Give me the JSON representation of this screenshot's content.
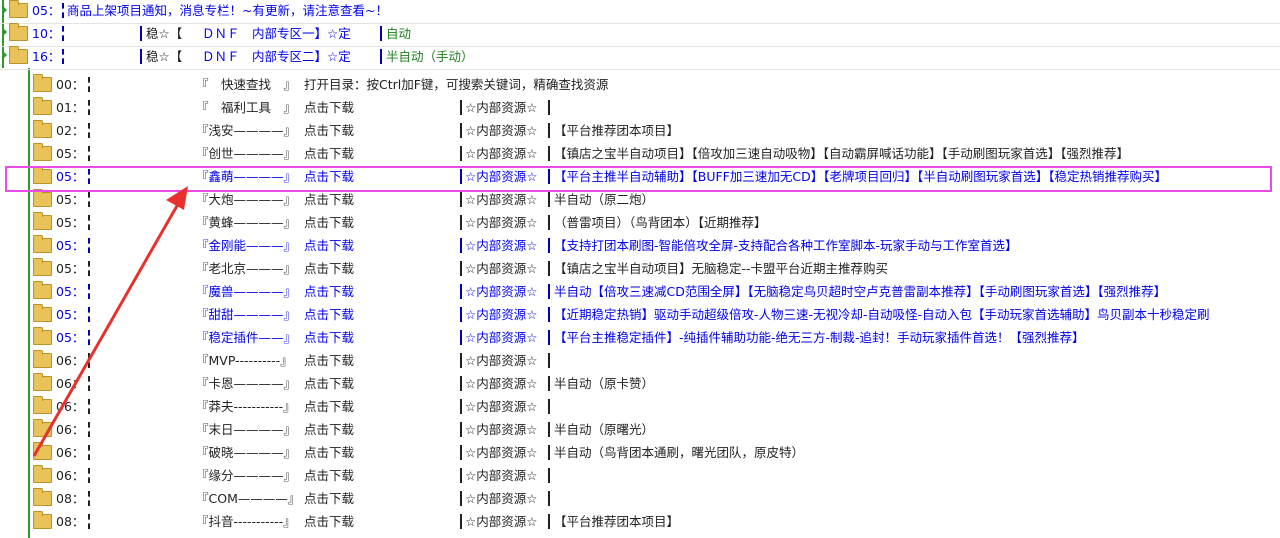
{
  "top_rows": [
    {
      "num": "05：",
      "text": "商品上架项目通知，消息专栏！~有更新，请注意查看~！"
    },
    {
      "num": "10：",
      "star_name": "稳☆【",
      "zone": "ＤＮＦ　内部专区一】☆定",
      "tag": "自动"
    },
    {
      "num": "16：",
      "star_name": "稳☆【",
      "zone": "ＤＮＦ　内部专区二】☆定",
      "tag": "半自动（手动）"
    }
  ],
  "rows": [
    {
      "num": "00：",
      "name": "『　快速查找　』",
      "action": "打开目录：按Ctrl加F键，可搜索关键词，精确查找资源",
      "res": "",
      "desc": "",
      "blue": false
    },
    {
      "num": "01：",
      "name": "『　福利工具　』",
      "action": "点击下载",
      "res": "☆内部资源☆",
      "desc": "",
      "blue": false
    },
    {
      "num": "02：",
      "name": "『浅安————』",
      "action": "点击下载",
      "res": "☆内部资源☆",
      "desc": "【平台推荐团本项目】",
      "blue": false
    },
    {
      "num": "05：",
      "name": "『创世————』",
      "action": "点击下载",
      "res": "☆内部资源☆",
      "desc": "【镇店之宝半自动项目】【倍攻加三速自动吸物】【自动霸屏喊话功能】【手动刷图玩家首选】【强烈推荐】",
      "blue": false
    },
    {
      "num": "05：",
      "name": "『鑫萌————』",
      "action": "点击下载",
      "res": "☆内部资源☆",
      "desc": "【平台主推半自动辅助】【BUFF加三速加无CD】【老牌项目回归】【半自动刷图玩家首选】【稳定热销推荐购买】",
      "blue": true
    },
    {
      "num": "05：",
      "name": "『大炮————』",
      "action": "点击下载",
      "res": "☆内部资源☆",
      "desc": "半自动（原二炮）",
      "blue": false
    },
    {
      "num": "05：",
      "name": "『黄蜂————』",
      "action": "点击下载",
      "res": "☆内部资源☆",
      "desc": "（普雷项目）（鸟背团本）【近期推荐】",
      "blue": false
    },
    {
      "num": "05：",
      "name": "『金刚能———』",
      "action": "点击下载",
      "res": "☆内部资源☆",
      "desc": "【支持打团本刷图-智能倍攻全屏-支持配合各种工作室脚本-玩家手动与工作室首选】",
      "blue": true
    },
    {
      "num": "05：",
      "name": "『老北京———』",
      "action": "点击下载",
      "res": "☆内部资源☆",
      "desc": "【镇店之宝半自动项目】无脑稳定--卡盟平台近期主推荐购买",
      "blue": false
    },
    {
      "num": "05：",
      "name": "『魔兽————』",
      "action": "点击下载",
      "res": "☆内部资源☆",
      "desc": "半自动【倍攻三速减CD范围全屏】【无脑稳定鸟贝超时空卢克普雷副本推荐】【手动刷图玩家首选】【强烈推荐】",
      "blue": true
    },
    {
      "num": "05：",
      "name": "『甜甜————』",
      "action": "点击下载",
      "res": "☆内部资源☆",
      "desc": "【近期稳定热销】驱动手动超级倍攻-人物三速-无视冷却-自动吸怪-自动入包【手动玩家首选辅助】鸟贝副本十秒稳定刷",
      "blue": true
    },
    {
      "num": "05：",
      "name": "『稳定插件——』",
      "action": "点击下载",
      "res": "☆内部资源☆",
      "desc": "【平台主推稳定插件】-纯插件辅助功能-绝无三方-制裁-追封！手动玩家插件首选！【强烈推荐】",
      "blue": true
    },
    {
      "num": "06：",
      "name": "『MVP----------』",
      "action": "点击下载",
      "res": "☆内部资源☆",
      "desc": "",
      "blue": false
    },
    {
      "num": "06：",
      "name": "『卡恩————』",
      "action": "点击下载",
      "res": "☆内部资源☆",
      "desc": "半自动（原卡赞）",
      "blue": false
    },
    {
      "num": "06：",
      "name": "『莽夫-----------』",
      "action": "点击下载",
      "res": "☆内部资源☆",
      "desc": "",
      "blue": false
    },
    {
      "num": "06：",
      "name": "『末日————』",
      "action": "点击下载",
      "res": "☆内部资源☆",
      "desc": "半自动（原曙光）",
      "blue": false
    },
    {
      "num": "06：",
      "name": "『破晓————』",
      "action": "点击下载",
      "res": "☆内部资源☆",
      "desc": "半自动（鸟背团本通刷，曙光团队，原皮特）",
      "blue": false
    },
    {
      "num": "06：",
      "name": "『缘分————』",
      "action": "点击下载",
      "res": "☆内部资源☆",
      "desc": "",
      "blue": false
    },
    {
      "num": "08：",
      "name": "『COM————』",
      "action": "点击下载",
      "res": "☆内部资源☆",
      "desc": "",
      "blue": false
    },
    {
      "num": "08：",
      "name": "『抖音-----------』",
      "action": "点击下载",
      "res": "☆内部资源☆",
      "desc": "【平台推荐团本项目】",
      "blue": false
    }
  ],
  "colors": {
    "highlight": "#e84ce8",
    "arrow": "#e8312e",
    "link": "#0000ee",
    "tree": "#2e9a2e"
  }
}
